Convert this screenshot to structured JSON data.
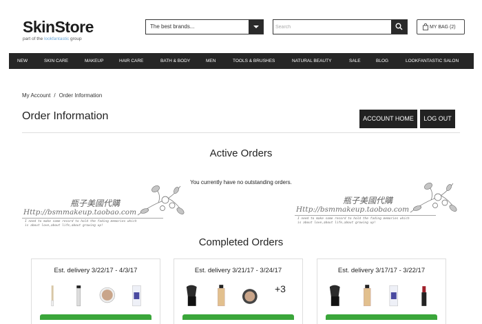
{
  "header": {
    "logo": "SkinStore",
    "logo_sub_pre": "part of the ",
    "logo_sub_brand": "lookfantastic",
    "logo_sub_post": " group",
    "brand_select_value": "The best brands...",
    "search_placeholder": "Search",
    "bag_label": "MY BAG (2)"
  },
  "nav": {
    "items": [
      "NEW",
      "SKIN CARE",
      "MAKEUP",
      "HAIR CARE",
      "BATH & BODY",
      "MEN",
      "TOOLS & BRUSHES",
      "NATURAL BEAUTY",
      "SALE",
      "BLOG",
      "LOOKFANTASTIC SALON"
    ]
  },
  "breadcrumb": {
    "items": [
      "My Account",
      "Order Information"
    ],
    "separator": "/"
  },
  "page": {
    "title": "Order Information",
    "account_home": "ACCOUNT HOME",
    "log_out": "LOG OUT",
    "active_title": "Active Orders",
    "no_orders": "You currently have no outstanding orders.",
    "completed_title": "Completed Orders"
  },
  "watermark": {
    "chinese": "瓶子美國代購",
    "url": "Http://bsmmakeup.taobao.com",
    "note_line1": "I need to make some record to hold the fading memories which",
    "note_line2": "is about love,about life,about growing up!"
  },
  "orders": [
    {
      "delivery": "Est. delivery 3/22/17 - 4/3/17",
      "more": ""
    },
    {
      "delivery": "Est. delivery 3/21/17 - 3/24/17",
      "more": "+3"
    },
    {
      "delivery": "Est. delivery 3/17/17 - 3/22/17",
      "more": ""
    }
  ],
  "colors": {
    "nav_bg": "#262626",
    "button_bg": "#222222",
    "order_bar": "#3aa63a",
    "brand_accent": "#6aa7d8"
  }
}
